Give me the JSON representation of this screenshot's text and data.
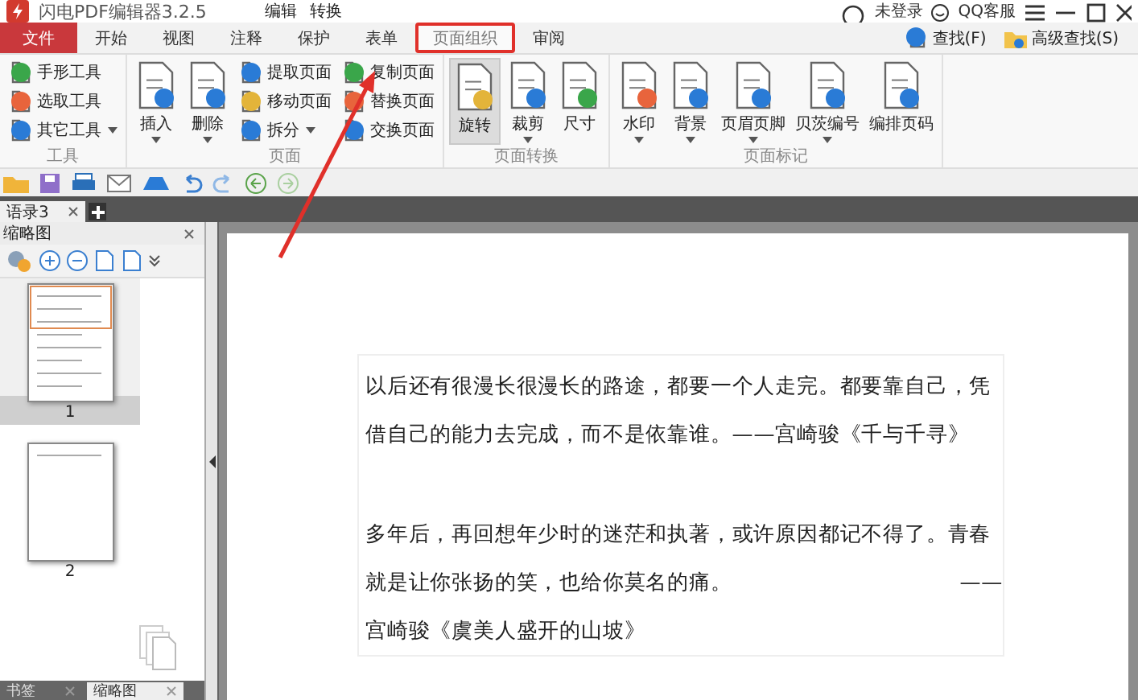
{
  "window": {
    "title": "闪电PDF编辑器3.2.5",
    "menus": [
      "编辑",
      "转换"
    ],
    "user": "未登录",
    "support": "QQ客服"
  },
  "ribbon_tabs": [
    {
      "label": "文件",
      "kind": "file",
      "selected": false,
      "highlighted": false
    },
    {
      "label": "开始",
      "kind": "tab",
      "selected": false,
      "highlighted": false
    },
    {
      "label": "视图",
      "kind": "tab",
      "selected": false,
      "highlighted": false
    },
    {
      "label": "注释",
      "kind": "tab",
      "selected": false,
      "highlighted": false
    },
    {
      "label": "保护",
      "kind": "tab",
      "selected": false,
      "highlighted": false
    },
    {
      "label": "表单",
      "kind": "tab",
      "selected": false,
      "highlighted": false
    },
    {
      "label": "页面组织",
      "kind": "tab",
      "selected": true,
      "highlighted": true
    },
    {
      "label": "审阅",
      "kind": "tab",
      "selected": false,
      "highlighted": false
    }
  ],
  "search_buttons": [
    "查找(F)",
    "高级查找(S)"
  ],
  "ribbon_groups": [
    {
      "title": "工具",
      "items": [
        {
          "label": "手形工具",
          "kind": "small",
          "dropdown": false,
          "pressed": false
        },
        {
          "label": "选取工具",
          "kind": "small",
          "dropdown": false,
          "pressed": false
        },
        {
          "label": "其它工具",
          "kind": "small",
          "dropdown": true,
          "pressed": false
        }
      ]
    },
    {
      "title": "页面",
      "items": [
        {
          "label": "插入",
          "kind": "large",
          "dropdown": true,
          "pressed": false
        },
        {
          "label": "删除",
          "kind": "large",
          "dropdown": true,
          "pressed": false
        },
        {
          "label": "提取页面",
          "kind": "small",
          "dropdown": false,
          "pressed": false
        },
        {
          "label": "移动页面",
          "kind": "small",
          "dropdown": false,
          "pressed": false
        },
        {
          "label": "拆分",
          "kind": "small",
          "dropdown": true,
          "pressed": false
        },
        {
          "label": "复制页面",
          "kind": "small",
          "dropdown": false,
          "pressed": false
        },
        {
          "label": "替换页面",
          "kind": "small",
          "dropdown": false,
          "pressed": false
        },
        {
          "label": "交换页面",
          "kind": "small",
          "dropdown": false,
          "pressed": false
        }
      ]
    },
    {
      "title": "页面转换",
      "items": [
        {
          "label": "旋转",
          "kind": "large",
          "dropdown": false,
          "pressed": true
        },
        {
          "label": "裁剪",
          "kind": "large",
          "dropdown": true,
          "pressed": false
        },
        {
          "label": "尺寸",
          "kind": "large",
          "dropdown": false,
          "pressed": false
        }
      ]
    },
    {
      "title": "页面标记",
      "items": [
        {
          "label": "水印",
          "kind": "large",
          "dropdown": true,
          "pressed": false
        },
        {
          "label": "背景",
          "kind": "large",
          "dropdown": true,
          "pressed": false
        },
        {
          "label": "页眉页脚",
          "kind": "large",
          "dropdown": true,
          "pressed": false
        },
        {
          "label": "贝茨编号",
          "kind": "large",
          "dropdown": true,
          "pressed": false
        },
        {
          "label": "编排页码",
          "kind": "large",
          "dropdown": false,
          "pressed": false
        }
      ]
    }
  ],
  "doc_tabs": [
    {
      "label": "语录3",
      "selected": true
    }
  ],
  "panel": {
    "title": "缩略图",
    "thumbnails": [
      {
        "label": "1",
        "selected": true
      },
      {
        "label": "2",
        "selected": false
      }
    ],
    "bottom_tabs": [
      {
        "label": "书签",
        "selected": false
      },
      {
        "label": "缩略图",
        "selected": true
      }
    ]
  },
  "document": {
    "lines": [
      {
        "kind": "text",
        "text": "以后还有很漫长很漫长的路途，都要一个人走完。都要靠自己，凭"
      },
      {
        "kind": "text",
        "text": "借自己的能力去完成，而不是依靠谁。——宫崎骏《千与千寻》"
      },
      {
        "kind": "gap"
      },
      {
        "kind": "text",
        "text": "多年后，再回想年少时的迷茫和执著，或许原因都记不得了。青春"
      },
      {
        "kind": "text",
        "text": "就是让你张扬的笑，也给你莫名的痛。",
        "trailing": "——"
      },
      {
        "kind": "text",
        "text": "宫崎骏《虞美人盛开的山坡》"
      }
    ]
  }
}
